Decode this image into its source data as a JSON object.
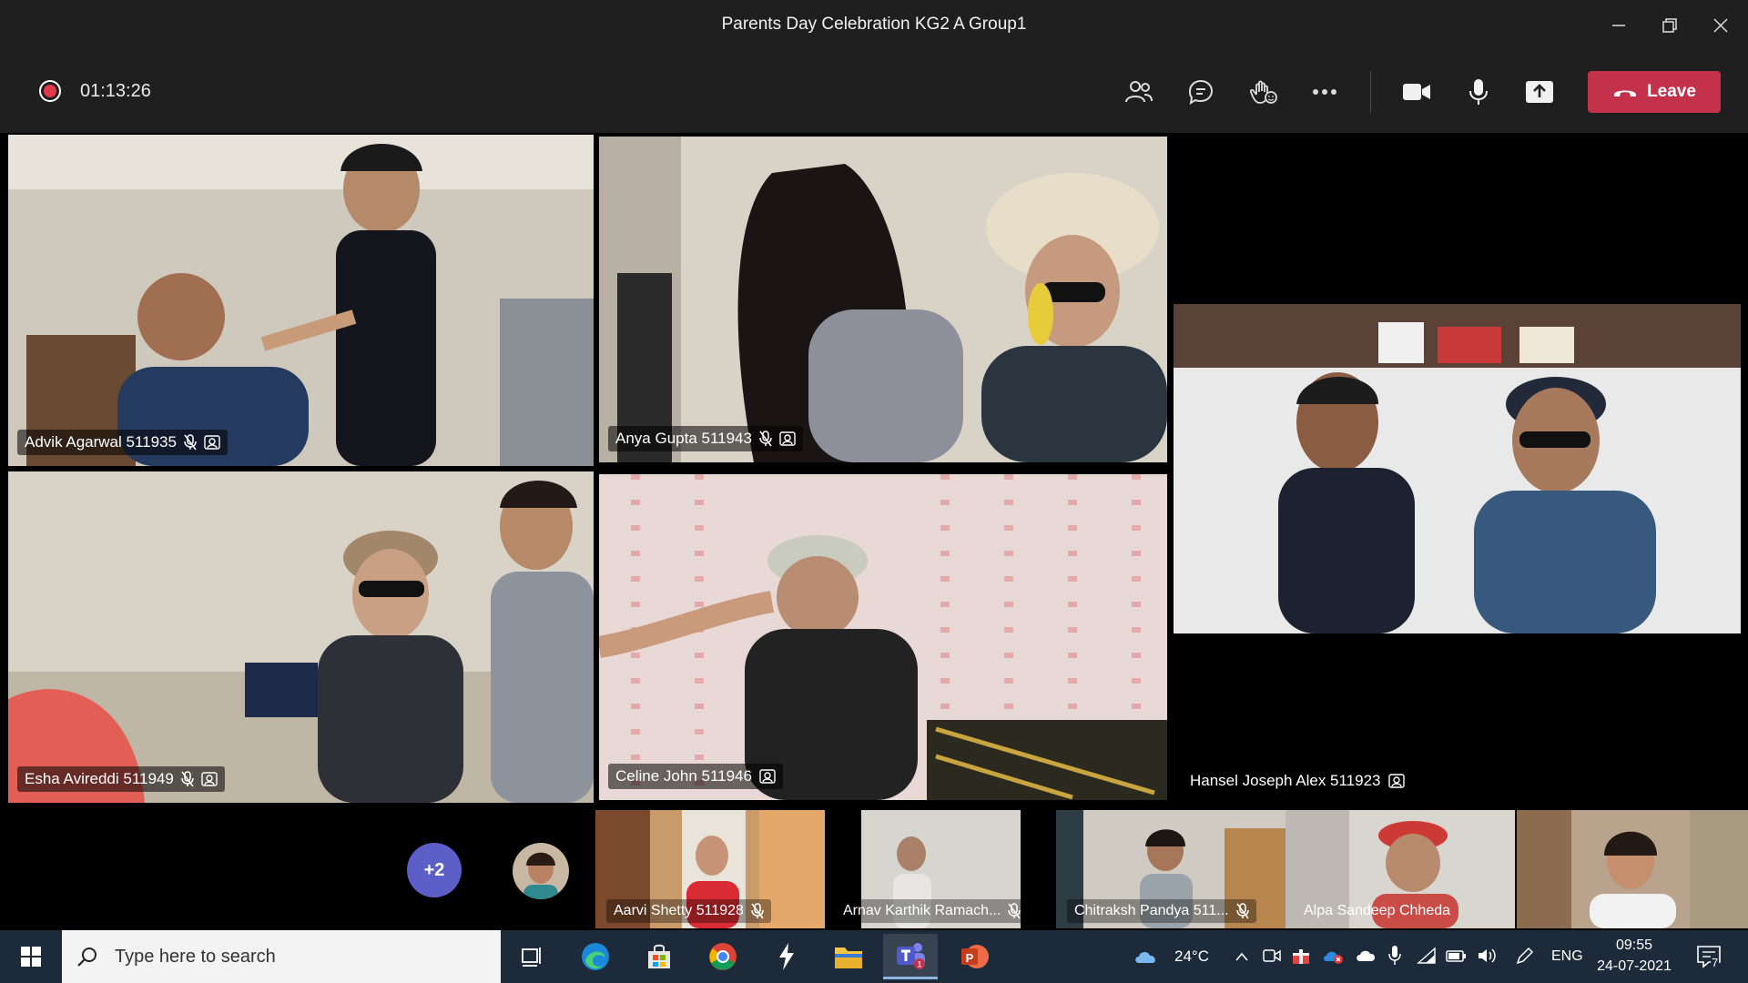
{
  "window": {
    "title": "Parents Day Celebration KG2 A Group1"
  },
  "toolbar": {
    "recording_time": "01:13:26",
    "leave_label": "Leave",
    "leave_color": "#c4314b",
    "icons": [
      "people-icon",
      "chat-icon",
      "reactions-icon",
      "more-options-icon",
      "camera-icon",
      "microphone-icon",
      "share-screen-icon",
      "hang-up-icon"
    ]
  },
  "tiles": [
    {
      "name": "Advik Agarwal 511935",
      "muted": true
    },
    {
      "name": "Anya Gupta 511943",
      "muted": true
    },
    {
      "name": "Hansel Joseph Alex 511923",
      "muted": false
    },
    {
      "name": "Esha Avireddi 511949",
      "muted": true
    },
    {
      "name": "Celine John 511946",
      "muted": false
    }
  ],
  "filmstrip": {
    "overflow_count": "+2",
    "thumbnails": [
      {
        "name": "Aarvi Shetty 511928"
      },
      {
        "name": "Arnav Karthik Ramach..."
      },
      {
        "name": "Chitraksh Pandya 511..."
      },
      {
        "name": "Alpa Sandeep Chheda"
      }
    ]
  },
  "taskbar": {
    "search_placeholder": "Type here to search",
    "weather": "24°C",
    "language": "ENG",
    "time": "09:55",
    "date": "24-07-2021",
    "notification_count": "7"
  }
}
